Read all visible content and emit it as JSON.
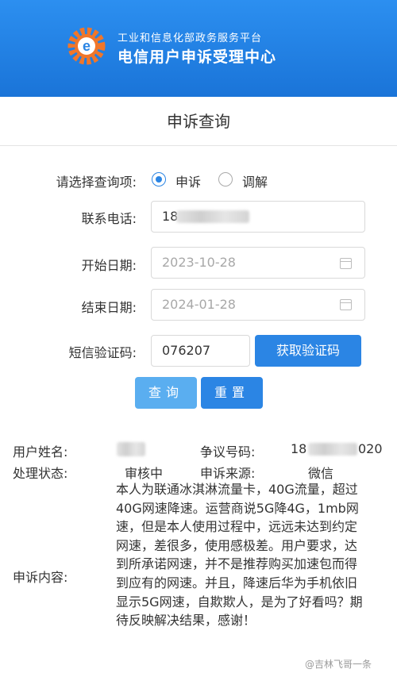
{
  "header": {
    "subtitle": "工业和信息化部政务服务平台",
    "title": "电信用户申诉受理中心",
    "colors": {
      "background": "#1f7fe3",
      "logo_orange": "#f0762a",
      "logo_blue": "#2b85e4"
    }
  },
  "page_title": "申诉查询",
  "form": {
    "query_type_label": "请选择查询项:",
    "query_type_options": [
      "申诉",
      "调解"
    ],
    "query_type_selected": "申诉",
    "phone_label": "联系电话:",
    "phone_value": "18",
    "start_date_label": "开始日期:",
    "start_date_value": "2023-10-28",
    "end_date_label": "结束日期:",
    "end_date_value": "2024-01-28",
    "sms_code_label": "短信验证码:",
    "sms_code_value": "076207",
    "get_code_button": "获取验证码",
    "query_button": "查询",
    "reset_button": "重置",
    "accent_color": "#2b85e4"
  },
  "result": {
    "user_name_label": "用户姓名:",
    "dispute_number_label": "争议号码:",
    "dispute_number_value": "18",
    "dispute_number_suffix": "020",
    "status_label": "处理状态:",
    "status_value": "审核中",
    "source_label": "申诉来源:",
    "source_value": "微信",
    "content_label": "申诉内容:",
    "content_value": "本人为联通冰淇淋流量卡，40G流量，超过40G网速降速。运营商说5G降4G，1mb网速，但是本人使用过程中，远远未达到约定网速，差很多，使用感极差。用户要求，达到所承诺网速，并不是推荐购买加速包而得到应有的网速。并且，降速后华为手机依旧显示5G网速，自欺欺人，是为了好看吗？期待反映解决结果，感谢！"
  },
  "watermark": "@吉林飞哥一条"
}
